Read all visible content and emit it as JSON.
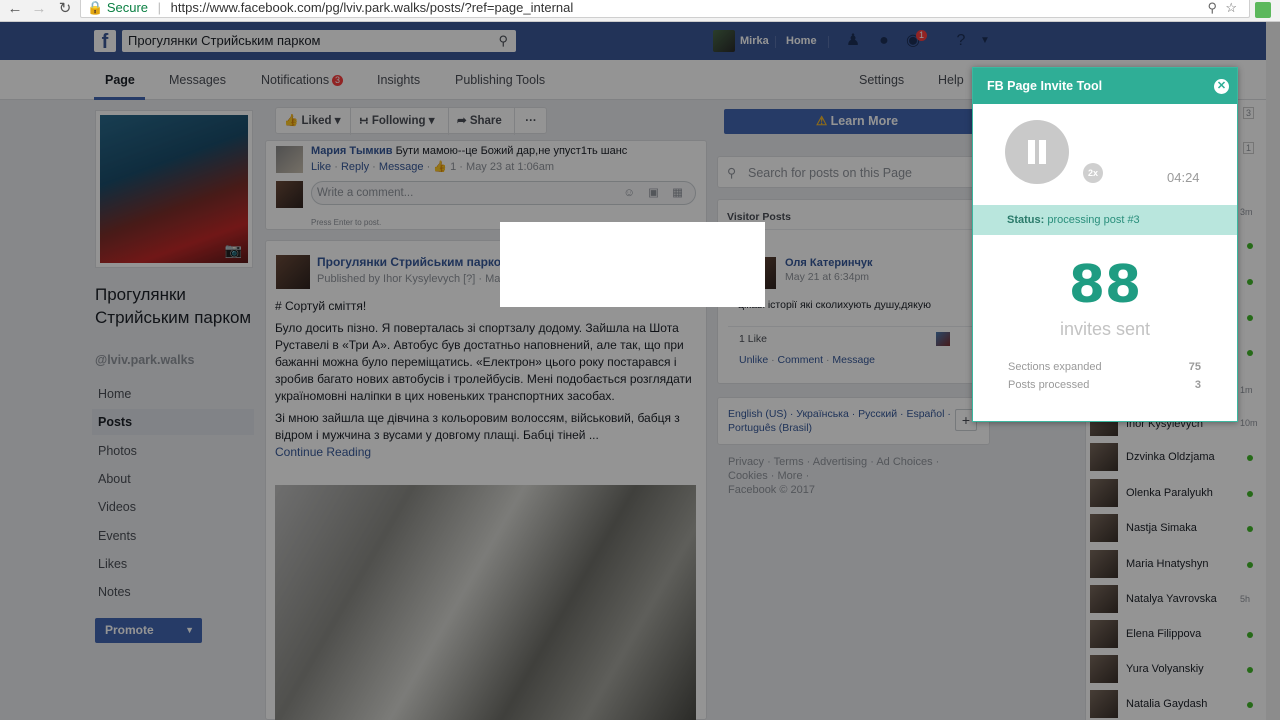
{
  "browser": {
    "secure_label": "Secure",
    "url": "https://www.facebook.com/pg/lviv.park.walks/posts/?ref=page_internal"
  },
  "topbar": {
    "search_value": "Прогулянки Стрийським парком",
    "user_name": "Mirka",
    "home_label": "Home",
    "notif_count": "1"
  },
  "page_nav": {
    "tabs": [
      "Page",
      "Messages",
      "Notifications",
      "Insights",
      "Publishing Tools"
    ],
    "notifications_badge": "3",
    "settings_label": "Settings",
    "help_label": "Help"
  },
  "left": {
    "page_name": "Прогулянки Стрийським парком",
    "handle": "@lviv.park.walks",
    "nav": [
      "Home",
      "Posts",
      "Photos",
      "About",
      "Videos",
      "Events",
      "Likes",
      "Notes"
    ],
    "promote_label": "Promote"
  },
  "actions": {
    "liked": "Liked",
    "following": "Following",
    "share": "Share",
    "more": "···"
  },
  "comment": {
    "author": "Мария Тымкив",
    "text": "Бути мамою--це Божий дар,не упуст1ть шанс",
    "like": "Like",
    "reply": "Reply",
    "message": "Message",
    "likes": "1",
    "time": "May 23 at 1:06am",
    "write_placeholder": "Write a comment...",
    "hint": "Press Enter to post."
  },
  "post": {
    "title": "Прогулянки Стрийським парком",
    "published_by": "Published by Ihor Kysylevych [?] · May",
    "hashtag": "# Сортуй сміття!",
    "para1": "Було досить пізно. Я поверталась зі спортзалу додому. Зайшла на Шота Руставелі в «Три А». Автобус був достатньо наповнений, але так, що при бажанні можна було переміщатись. «Електрон» цього року постарався і зробив багато нових автобусів і тролейбусів. Мені подобається розглядати україномовні наліпки в цих новеньких транспортних засобах.",
    "para2": "Зі мною зайшла ще дівчина з кольоровим волоссям, військовий, бабця з відром і мужчина з вусами у довгому плащі. Бабці тіней ...",
    "continue": "Continue Reading"
  },
  "right": {
    "learn_more": "Learn More",
    "search_posts_placeholder": "Search for posts on this Page",
    "visitor_posts_title": "Visitor Posts",
    "visitor_name": "Оля Катеринчук",
    "visitor_time": "May 21 at 6:34pm",
    "visitor_text": "цікаві історії які сколихують душу,дякую",
    "visitor_likes": "1 Like",
    "unlike": "Unlike",
    "comment": "Comment",
    "message": "Message",
    "languages": "English (US) · Українська · Русский · Español · Português (Brasil)",
    "footer_links": "Privacy · Terms · Advertising · Ad Choices · Cookies · More ·",
    "copyright": "Facebook © 2017"
  },
  "chat": {
    "partial_name": "Ihor Kysylevych",
    "partial_time": "10m",
    "contacts": [
      {
        "name": "Dzvinka Oldzjama",
        "time": ""
      },
      {
        "name": "Olenka Paralyukh",
        "time": ""
      },
      {
        "name": "Nastja Simaka",
        "time": ""
      },
      {
        "name": "Maria Hnatyshyn",
        "time": ""
      },
      {
        "name": "Natalya Yavrovska",
        "time": "5h"
      },
      {
        "name": "Elena Filippova",
        "time": ""
      },
      {
        "name": "Yura Volyanskiy",
        "time": ""
      },
      {
        "name": "Natalia Gaydash",
        "time": ""
      }
    ],
    "side_counts": [
      "3",
      "1"
    ],
    "side_times": [
      "3m",
      "1m"
    ]
  },
  "extension": {
    "title": "FB Page Invite Tool",
    "speed": "2x",
    "timer": "04:24",
    "status_label": "Status:",
    "status_text": "processing post #3",
    "invites_count": "88",
    "invites_label": "invites sent",
    "sections_label": "Sections expanded",
    "sections_value": "75",
    "posts_label": "Posts processed",
    "posts_value": "3",
    "accent_color": "#2fae96"
  }
}
